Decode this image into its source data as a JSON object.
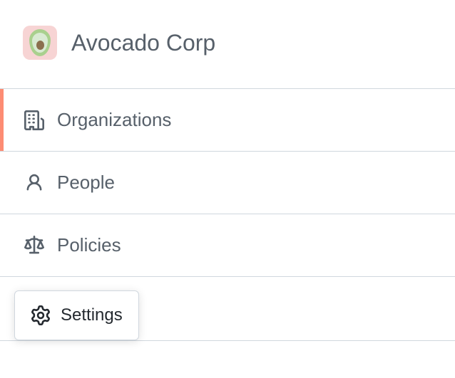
{
  "header": {
    "title": "Avocado Corp"
  },
  "sidebar": {
    "items": [
      {
        "label": "Organizations",
        "icon": "organization-icon",
        "active": true
      },
      {
        "label": "People",
        "icon": "person-icon",
        "active": false
      },
      {
        "label": "Policies",
        "icon": "law-icon",
        "active": false
      },
      {
        "label": "Settings",
        "icon": "gear-icon",
        "active": false
      }
    ]
  }
}
